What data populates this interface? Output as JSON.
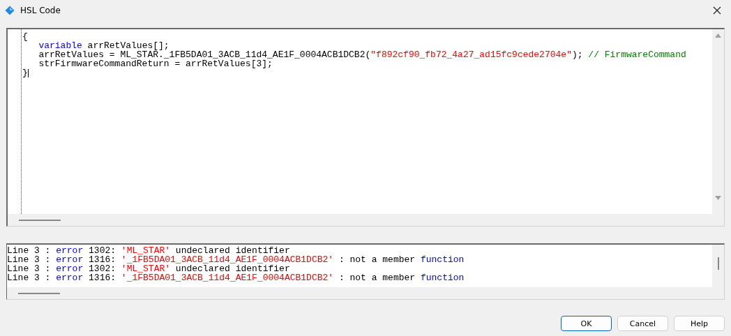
{
  "window": {
    "title": "HSL Code"
  },
  "code": {
    "lines": [
      {
        "indented": false,
        "tokens": [
          {
            "kind": "plain",
            "text": "{"
          }
        ]
      },
      {
        "indented": true,
        "tokens": [
          {
            "kind": "keyword",
            "text": "variable"
          },
          {
            "kind": "plain",
            "text": " arrRetValues[];"
          }
        ]
      },
      {
        "indented": true,
        "tokens": [
          {
            "kind": "plain",
            "text": "arrRetValues = ML_STAR._1FB5DA01_3ACB_11d4_AE1F_0004ACB1DCB2("
          },
          {
            "kind": "string",
            "text": "\"f892cf90_fb72_4a27_ad15fc9cede2704e\""
          },
          {
            "kind": "plain",
            "text": "); "
          },
          {
            "kind": "comment",
            "text": "// FirmwareCommand"
          }
        ]
      },
      {
        "indented": true,
        "tokens": [
          {
            "kind": "plain",
            "text": "strFirmwareCommandReturn = arrRetValues[3];"
          }
        ]
      },
      {
        "indented": false,
        "tokens": [
          {
            "kind": "plain",
            "text": "}"
          }
        ]
      }
    ]
  },
  "errors": [
    [
      {
        "kind": "plain",
        "text": "Line 3 : "
      },
      {
        "kind": "keyword",
        "text": "error"
      },
      {
        "kind": "plain",
        "text": " 1302: "
      },
      {
        "kind": "string",
        "text": "'ML_STAR'"
      },
      {
        "kind": "plain",
        "text": " undeclared identifier"
      }
    ],
    [
      {
        "kind": "plain",
        "text": "Line 3 : "
      },
      {
        "kind": "keyword",
        "text": "error"
      },
      {
        "kind": "plain",
        "text": " 1316: "
      },
      {
        "kind": "string",
        "text": "'_1FB5DA01_3ACB_11d4_AE1F_0004ACB1DCB2'"
      },
      {
        "kind": "plain",
        "text": " : not a member "
      },
      {
        "kind": "keyword",
        "text": "function"
      }
    ],
    [
      {
        "kind": "plain",
        "text": "Line 3 : "
      },
      {
        "kind": "keyword",
        "text": "error"
      },
      {
        "kind": "plain",
        "text": " 1302: "
      },
      {
        "kind": "string",
        "text": "'ML_STAR'"
      },
      {
        "kind": "plain",
        "text": " undeclared identifier"
      }
    ],
    [
      {
        "kind": "plain",
        "text": "Line 3 : "
      },
      {
        "kind": "keyword",
        "text": "error"
      },
      {
        "kind": "plain",
        "text": " 1316: "
      },
      {
        "kind": "string",
        "text": "'_1FB5DA01_3ACB_11d4_AE1F_0004ACB1DCB2'"
      },
      {
        "kind": "plain",
        "text": " : not a member "
      },
      {
        "kind": "keyword",
        "text": "function"
      }
    ]
  ],
  "buttons": [
    {
      "label": "OK",
      "default": true
    },
    {
      "label": "Cancel",
      "default": false
    },
    {
      "label": "Help",
      "default": false
    }
  ]
}
